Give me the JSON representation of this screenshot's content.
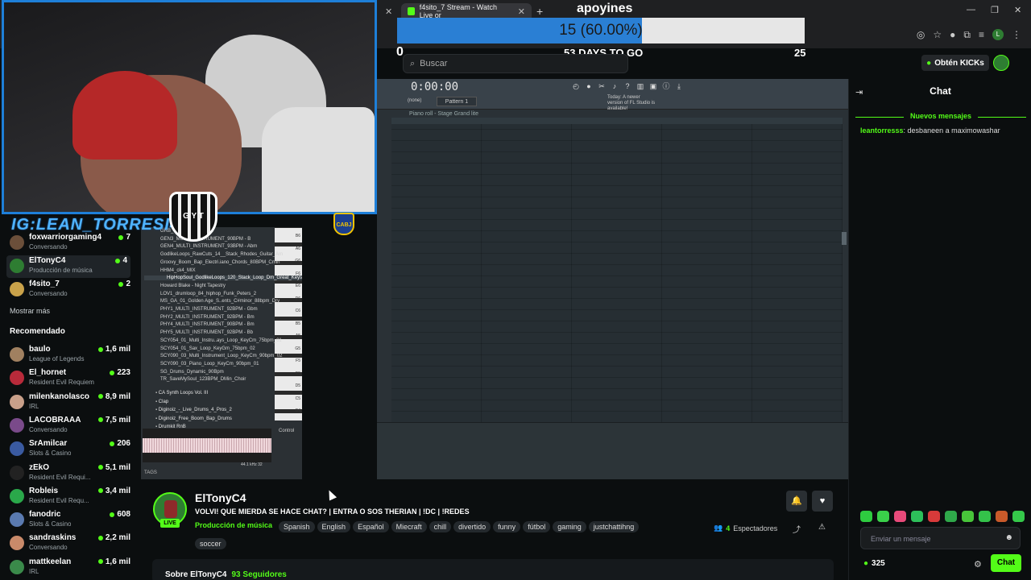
{
  "browser": {
    "tabs": [
      {
        "title": "f4sito_7 Stream - Watch Live or"
      }
    ],
    "extension_letter": "L"
  },
  "goal": {
    "title": "apoyines",
    "progress_text": "15 (60.00%)",
    "progress_fraction": 0.6,
    "start": "0",
    "days_to_go": "53 DAYS TO GO",
    "target": "25"
  },
  "header": {
    "search_placeholder": "Buscar",
    "kicks_button": "Obtén KICKs"
  },
  "overlay": {
    "ig_handle": "IG:LEAN_TORRESI4",
    "shield_text": "G Y T",
    "boca_text": "CABJ"
  },
  "sidebar": {
    "following": [
      {
        "name": "foxwarriorgaming4",
        "sub": "Conversando",
        "viewers": "7",
        "color": "#6b4f3a"
      },
      {
        "name": "ElTonyC4",
        "sub": "Producción de música",
        "viewers": "4",
        "color": "#2e7d32"
      },
      {
        "name": "f4sito_7",
        "sub": "Conversando",
        "viewers": "2",
        "color": "#c9a24a"
      }
    ],
    "show_more": "Mostrar más",
    "recommended_heading": "Recomendado",
    "recommended": [
      {
        "name": "baulo",
        "sub": "League of Legends",
        "viewers": "1,6 mil",
        "color": "#a08060"
      },
      {
        "name": "El_hornet",
        "sub": "Resident Evil Requiem",
        "viewers": "223",
        "color": "#b82a3a"
      },
      {
        "name": "milenkanolasco",
        "sub": "IRL",
        "viewers": "8,9 mil",
        "color": "#c9a08a"
      },
      {
        "name": "LACOBRAAA",
        "sub": "Conversando",
        "viewers": "7,5 mil",
        "color": "#7a4a8a"
      },
      {
        "name": "SrAmilcar",
        "sub": "Slots & Casino",
        "viewers": "206",
        "color": "#3a5aa0"
      },
      {
        "name": "zEkO",
        "sub": "Resident Evil Requi...",
        "viewers": "5,1 mil",
        "color": "#222222"
      },
      {
        "name": "Robleis",
        "sub": "Resident Evil Requ...",
        "viewers": "3,4 mil",
        "color": "#2aa84a"
      },
      {
        "name": "fanodric",
        "sub": "Slots & Casino",
        "viewers": "608",
        "color": "#5a7ab0"
      },
      {
        "name": "sandraskins",
        "sub": "Conversando",
        "viewers": "2,2 mil",
        "color": "#c98a6a"
      },
      {
        "name": "mattkeelan",
        "sub": "IRL",
        "viewers": "1,6 mil",
        "color": "#3a8a4a"
      }
    ]
  },
  "fl_studio": {
    "time": "0:00:00",
    "pattern": "Pattern 1",
    "none_label": "(none)",
    "notice": "Today: A newer version of FL Studio is available!",
    "piano_roll_title": "Piano roll - Stage Grand lite",
    "control_label": "Control",
    "browser_items": [
      "GRB_Lo_Loop_C#m_92",
      "GEN3_MULTI_INSTRUMENT_90BPM - B",
      "GEN4_MULTI_INSTRUMENT_93BPM - Abm",
      "GodlikeLoops_RawCuts_14__Stack_Rhodes_Guitar_Am",
      "Groovy_Boom_Bap_Electri.iano_Chords_80BPM_Cmin",
      "HHM4_ck4_MIX",
      "HipHopSoul_GodlikeLoops_120_Stack_Loop_Dm_Great_Keys_Flute",
      "Howard Blake - Night Tapestry",
      "LOV1_drumloop_84_hiphop_Funk_Peters_2",
      "MS_GA_01_Golden Age_S..ents_C#minor_88bpm_Dry",
      "PHY1_MULTI_INSTRUMENT_92BPM - Gbm",
      "PHY2_MULTI_INSTRUMENT_92BPM - Bm",
      "PHY4_MULTI_INSTRUMENT_90BPM - Bm",
      "PHY5_MULTI_INSTRUMENT_92BPM - Bb",
      "SCY054_01_Multi_Instru..ays_Loop_KeyCm_75bpm_01",
      "SCY054_01_Sax_Loop_KeyGm_75bpm_02",
      "SCY090_03_Multi_Instrument_Loop_KeyCm_90bpm_02",
      "SCY090_03_Piano_Loop_KeyCm_90bpm_01",
      "SG_Drums_Dynamic_90Bpm",
      "TR_SaveMySoul_123BPM_DMin_Choir"
    ],
    "browser_folders": [
      "CA Synth Loops Vol. III",
      "Clap",
      "Diginoiz_-_Live_Drums_4_Pros_2",
      "Diginoiz_Free_Boom_Bap_Drums",
      "Drumkit RnB"
    ],
    "key_labels": [
      "B6",
      "A6",
      "G6",
      "F6",
      "E6",
      "D6",
      "C6",
      "B5",
      "A5",
      "G5",
      "F5",
      "E5",
      "D5",
      "C5",
      "B4"
    ],
    "wave_info": "44.1 kHz 32",
    "tags_label": "TAGS"
  },
  "chat": {
    "title": "Chat",
    "new_messages": "Nuevos mensajes",
    "messages": [
      {
        "user": "leantorresss",
        "text": "desbaneen a maximowashar"
      }
    ],
    "input_placeholder": "Enviar un mensaje",
    "kicks": "325",
    "send_label": "Chat",
    "emote_colors": [
      "#2ecc40",
      "#3ad14a",
      "#e84a7a",
      "#2dbf5a",
      "#d83a3a",
      "#2fa84a",
      "#48c53a",
      "#34c24a",
      "#c85a2a",
      "#35c84a"
    ]
  },
  "stream": {
    "streamer": "ElTonyC4",
    "live": "LIVE",
    "title": "VOLVI! QUE MIERDA SE HACE CHAT? | ENTRA O SOS THERIAN | !DC | !REDES",
    "category": "Producción de música",
    "tags": [
      "Spanish",
      "English",
      "Español",
      "Miecraft",
      "chill",
      "divertido",
      "funny",
      "fútbol",
      "gaming",
      "justchattihng"
    ],
    "tags_row2": [
      "soccer"
    ],
    "viewers_count": "4",
    "viewers_label": "Espectadores",
    "about_title": "Sobre ElTonyC4",
    "followers": "93 Seguidores"
  },
  "colors": {
    "accent": "#53fc18",
    "goal_fill": "#2a7fd4",
    "webcam_border": "#1e7fd8"
  }
}
